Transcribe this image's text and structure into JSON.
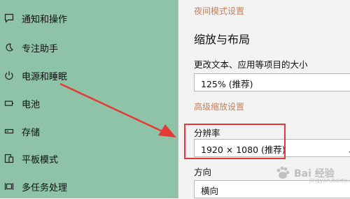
{
  "sidebar": {
    "items": [
      {
        "label": "通知和操作",
        "icon": "notification-icon"
      },
      {
        "label": "专注助手",
        "icon": "moon-icon"
      },
      {
        "label": "电源和睡眠",
        "icon": "power-icon"
      },
      {
        "label": "电池",
        "icon": "battery-icon"
      },
      {
        "label": "存储",
        "icon": "storage-icon"
      },
      {
        "label": "平板模式",
        "icon": "tablet-mode-icon"
      },
      {
        "label": "多任务处理",
        "icon": "multitasking-icon"
      }
    ]
  },
  "main": {
    "night_light_link": "夜间模式设置",
    "scale_heading": "缩放与布局",
    "text_size_label": "更改文本、应用等项目的大小",
    "scale_value": "125% (推荐)",
    "advanced_scaling_link": "高级缩放设置",
    "resolution_label": "分辨率",
    "resolution_value": "1920 × 1080 (推荐)",
    "orientation_label": "方向",
    "orientation_value": "横向"
  },
  "annotation": {
    "arrow_color": "#e53935",
    "box_color": "#e53935"
  },
  "watermark": {
    "text": "Bai 经验",
    "sub": "jingyan.baidu.com"
  },
  "colors": {
    "sidebar_bg": "#8ec3a7",
    "link": "#c4805c",
    "main_bg": "#f3f3f3"
  }
}
